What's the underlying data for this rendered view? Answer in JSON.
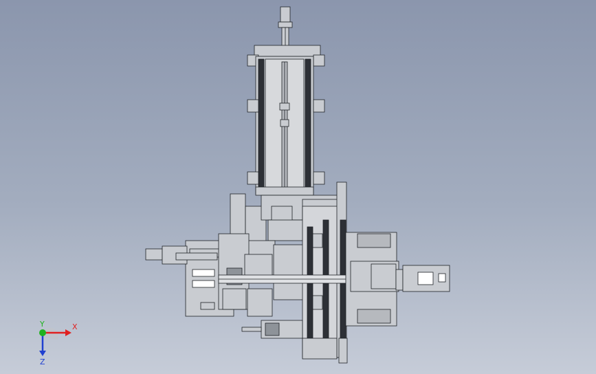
{
  "window": {
    "title": ""
  },
  "viewport": {
    "background_top": "#8b96ad",
    "background_bottom": "#c6ccd8",
    "model_color": "#c9ccd1",
    "edge_color": "#1e2126"
  },
  "triad": {
    "x_label": "X",
    "y_label": "Y",
    "z_label": "Z",
    "x_color": "#e02020",
    "y_color": "#1fb21f",
    "z_color": "#2040d0"
  }
}
